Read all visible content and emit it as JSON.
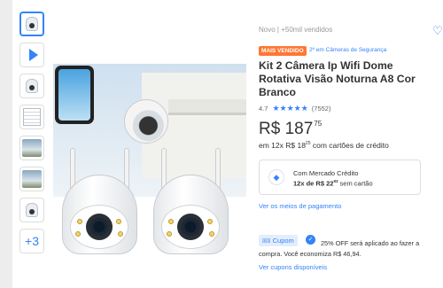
{
  "thumbnails": [
    {
      "kind": "camera",
      "active": true
    },
    {
      "kind": "video",
      "active": false
    },
    {
      "kind": "camera",
      "active": false
    },
    {
      "kind": "document",
      "active": false
    },
    {
      "kind": "scene",
      "active": false
    },
    {
      "kind": "scene",
      "active": false
    },
    {
      "kind": "camera",
      "active": false
    }
  ],
  "more_photos": "+3",
  "product": {
    "condition_sold": "Novo  |  +50mil vendidos",
    "badge": "MAIS VENDIDO",
    "category_rank": "2º em Câmeras de Segurança",
    "title": "Kit 2 Câmera Ip Wifi Dome Rotativa Visão Noturna A8 Cor Branco",
    "rating_value": "4.7",
    "stars": "★★★★★",
    "review_count": "(7552)",
    "price_int": "R$ 187",
    "price_cents": "75",
    "installment_prefix": "em 12x R$ 18",
    "installment_cents": "25",
    "installment_suffix": " com cartões de crédito"
  },
  "mercado_credito": {
    "icon": "mercado-credito-icon",
    "line1": "Com Mercado Crédito",
    "line2_prefix": "12x de R$ 22",
    "line2_cents": "93",
    "line2_suffix": " sem cartão"
  },
  "payment_link": "Ver os meios de pagamento",
  "coupon": {
    "tag": "Cupom",
    "text_line1": "25% OFF será aplicado ao fazer a",
    "text_line2": "compra. Você economiza R$ 46,94.",
    "link": "Ver cupons disponíveis"
  },
  "colors": {
    "accent": "#3483fa",
    "badge": "#ff7733"
  }
}
